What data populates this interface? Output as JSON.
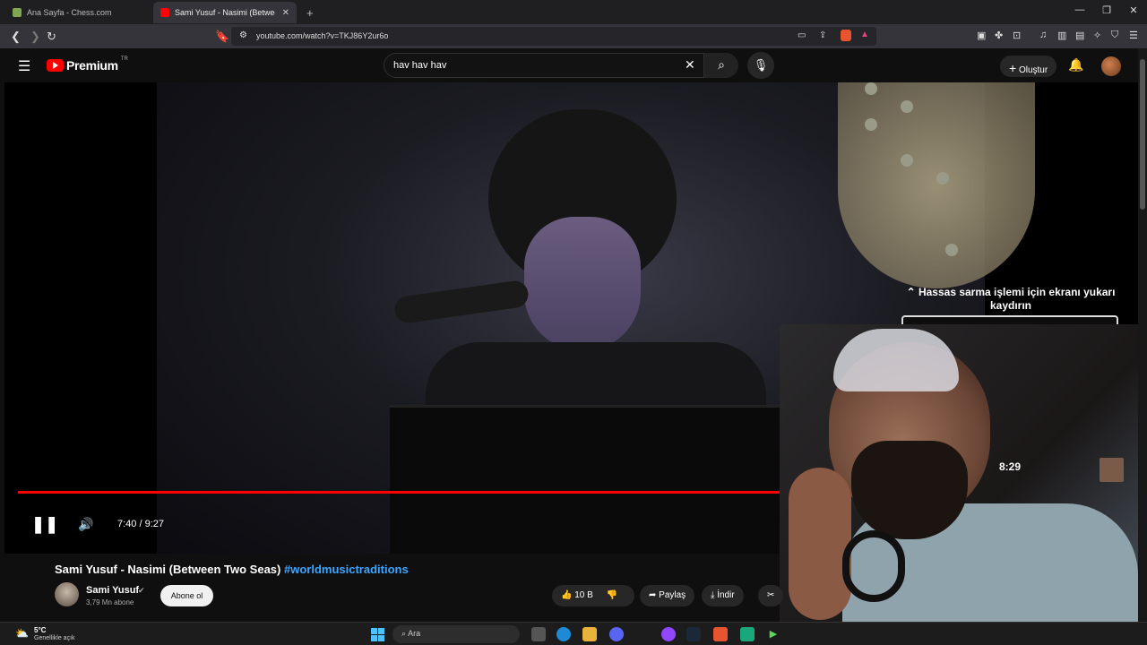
{
  "browser": {
    "tabs": [
      {
        "title": "Ana Sayfa - Chess.com"
      },
      {
        "title": "Sami Yusuf - Nasimi (Between"
      }
    ],
    "new_tab": "+",
    "url": "youtube.com/watch?v=TKJ86Y2ur6o"
  },
  "youtube": {
    "logo_text": "Premium",
    "logo_region": "TR",
    "search_value": "hav hav hav",
    "create_label": "Oluştur"
  },
  "player": {
    "current_time": "7:40",
    "duration": "9:27",
    "time_display": "7:40 / 9:27",
    "progress_fraction": 0.81
  },
  "miniplayer": {
    "scroll_hint": "Hassas sarma işlemi için ekranı yukarı kaydırın",
    "preview_time": "8:29"
  },
  "video": {
    "title": "Sami Yusuf - Nasimi (Between Two Seas)",
    "hashtag": "#worldmusictraditions",
    "channel_name": "Sami Yusuf",
    "subscribers": "3,79 Mn abone",
    "subscribe_label": "Abone ol",
    "like_count": "10 B",
    "share_label": "Paylaş",
    "download_label": "İndir"
  },
  "taskbar": {
    "temperature": "5°C",
    "weather": "Genellikle açık",
    "search_label": "Ara"
  },
  "colors": {
    "progress": "#ff0000",
    "hashtag": "#3ea6ff",
    "yt_red": "#ff0000"
  }
}
